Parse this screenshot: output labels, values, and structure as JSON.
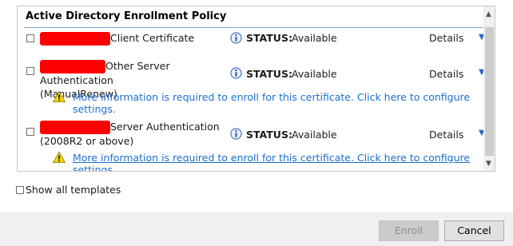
{
  "panel": {
    "title": "Active Directory Enrollment Policy"
  },
  "rows": [
    {
      "name_line1": "Client Certificate",
      "status_label": "STATUS:",
      "status_value": "Available",
      "details_label": "Details"
    },
    {
      "name_line1": "Other Server Authentication",
      "name_line2": "(ManualRenew)",
      "status_label": "STATUS:",
      "status_value": "Available",
      "details_label": "Details",
      "warning": "More information is required to enroll for this certificate. Click here to configure settings."
    },
    {
      "name_line1": "Server Authentication",
      "name_line2": "(2008R2 or above)",
      "status_label": "STATUS:",
      "status_value": "Available",
      "details_label": "Details",
      "warning": "More information is required to enroll for this certificate. Click here to configure settings."
    }
  ],
  "show_all_label": "Show all templates",
  "buttons": {
    "enroll": "Enroll",
    "cancel": "Cancel"
  },
  "icons": {
    "info": "info-icon",
    "warning": "warning-icon",
    "details_chevron": "chevron-down-icon",
    "scroll_up": "scroll-up-icon",
    "scroll_down": "scroll-down-icon"
  },
  "colors": {
    "link": "#1a6fd1",
    "header_rule": "#7fa6d9",
    "redaction": "#ff0000",
    "warning_fill": "#f5d800"
  }
}
